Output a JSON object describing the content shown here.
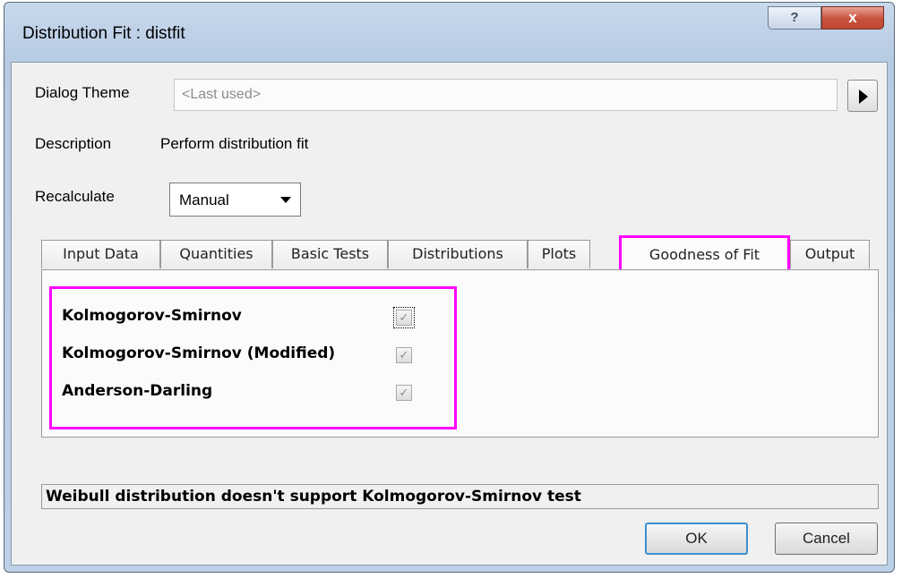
{
  "window": {
    "title": "Distribution Fit : distfit",
    "help_label": "?",
    "close_label": "x"
  },
  "dialog_theme": {
    "label": "Dialog Theme",
    "value": "<Last used>"
  },
  "description": {
    "label": "Description",
    "value": "Perform distribution fit"
  },
  "recalculate": {
    "label": "Recalculate",
    "selected": "Manual"
  },
  "tabs": [
    {
      "label": "Input Data"
    },
    {
      "label": "Quantities"
    },
    {
      "label": "Basic Tests"
    },
    {
      "label": "Distributions"
    },
    {
      "label": "Plots"
    },
    {
      "label": "Goodness of Fit"
    },
    {
      "label": "Output"
    }
  ],
  "active_tab": "Goodness of Fit",
  "options": [
    {
      "label": "Kolmogorov-Smirnov",
      "checked": true
    },
    {
      "label": "Kolmogorov-Smirnov (Modified)",
      "checked": true
    },
    {
      "label": "Anderson-Darling",
      "checked": true
    }
  ],
  "status_message": "Weibull distribution doesn't support Kolmogorov-Smirnov test",
  "buttons": {
    "ok": "OK",
    "cancel": "Cancel"
  },
  "colors": {
    "highlight": "#ff00ff",
    "default_button_border": "#3a8fd0",
    "close_button": "#c7503a"
  }
}
